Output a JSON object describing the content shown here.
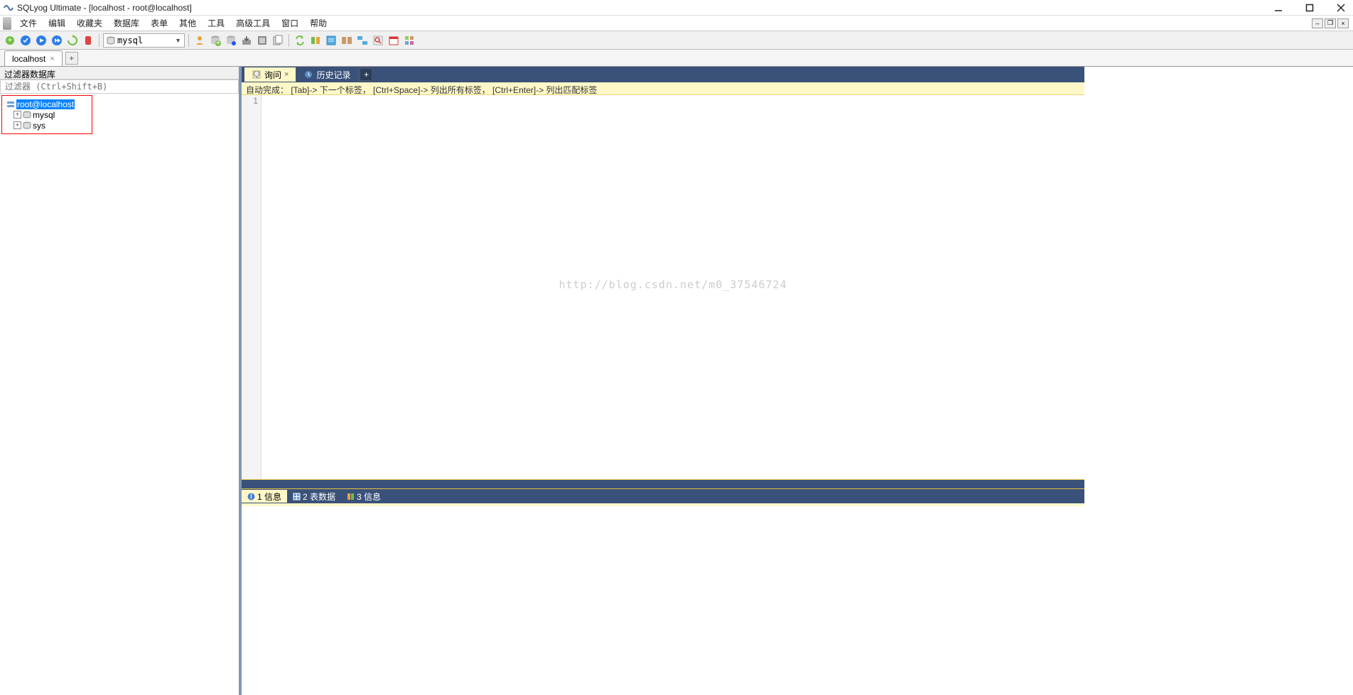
{
  "title": "SQLyog Ultimate - [localhost - root@localhost]",
  "menu": [
    "文件",
    "编辑",
    "收藏夹",
    "数据库",
    "表单",
    "其他",
    "工具",
    "高级工具",
    "窗口",
    "帮助"
  ],
  "db_combo": {
    "value": "mysql"
  },
  "conn_tab": {
    "label": "localhost"
  },
  "sidebar": {
    "filter_header": "过滤器数据库",
    "filter_placeholder": "过滤器 (Ctrl+Shift+B)",
    "root": "root@localhost",
    "children": [
      "mysql",
      "sys"
    ]
  },
  "query_tabs": {
    "active": "询问",
    "history": "历史记录"
  },
  "hint": "自动完成： [Tab]-> 下一个标签， [Ctrl+Space]-> 列出所有标签， [Ctrl+Enter]-> 列出匹配标签",
  "gutter_line": "1",
  "watermark": "http://blog.csdn.net/m0_37546724",
  "result_tabs": {
    "t1": "1 信息",
    "t2": "2 表数据",
    "t3": "3 信息"
  }
}
